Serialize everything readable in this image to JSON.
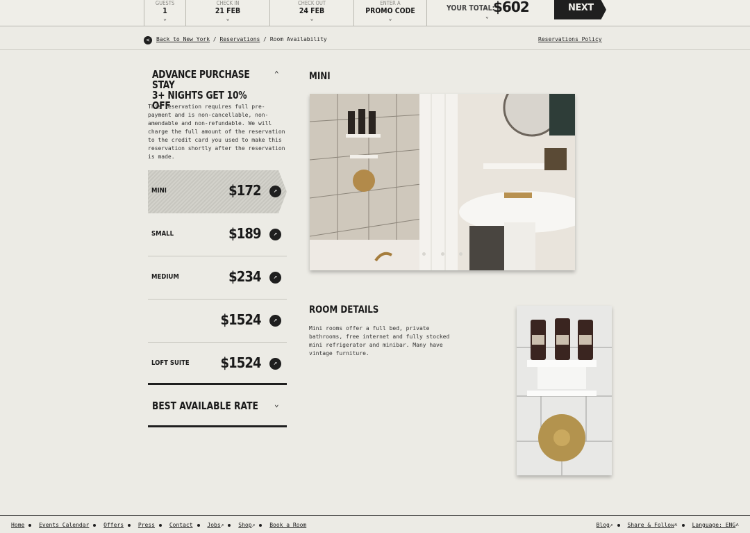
{
  "booking": {
    "guests": {
      "label": "GUESTS",
      "value": "1"
    },
    "check_in": {
      "label": "CHECK IN",
      "value": "21 FEB"
    },
    "check_out": {
      "label": "CHECK OUT",
      "value": "24 FEB"
    },
    "promo": {
      "label": "ENTER A",
      "value": "PROMO CODE"
    },
    "total_label": "YOUR TOTAL:",
    "total_value": "$602",
    "next_label": "NEXT"
  },
  "breadcrumb": {
    "back": "Back to New York",
    "sep1": "/",
    "reservations": "Reservations",
    "sep2": "/",
    "current": "Room Availability",
    "policy": "Reservations Policy"
  },
  "rate": {
    "title_line1": "ADVANCE PURCHASE STAY",
    "title_line2": "3+ NIGHTS GET 10% OFF",
    "description": "This reservation requires full pre-payment and is non-cancellable, non-amendable and non-refundable. We will charge the full amount of the reservation to the credit card you used to make this reservation shortly after the reservation is made.",
    "rooms": [
      {
        "name": "MINI",
        "price": "$172"
      },
      {
        "name": "SMALL",
        "price": "$189"
      },
      {
        "name": "MEDIUM",
        "price": "$234"
      },
      {
        "name": "",
        "price": "$1524"
      },
      {
        "name": "LOFT SUITE",
        "price": "$1524"
      }
    ],
    "best_rate": "BEST AVAILABLE RATE"
  },
  "main": {
    "room_title": "MINI",
    "details_title": "ROOM DETAILS",
    "details_text": "Mini rooms offer a full bed, private bathrooms, free internet and fully stocked mini refrigerator and minibar. Many have vintage furniture."
  },
  "footer": {
    "left": [
      "Home",
      "Events Calendar",
      "Offers",
      "Press",
      "Contact",
      "Jobs",
      "Shop",
      "Book a Room"
    ],
    "right": [
      "Blog",
      "Share & Follow",
      "Language: ENG"
    ]
  }
}
